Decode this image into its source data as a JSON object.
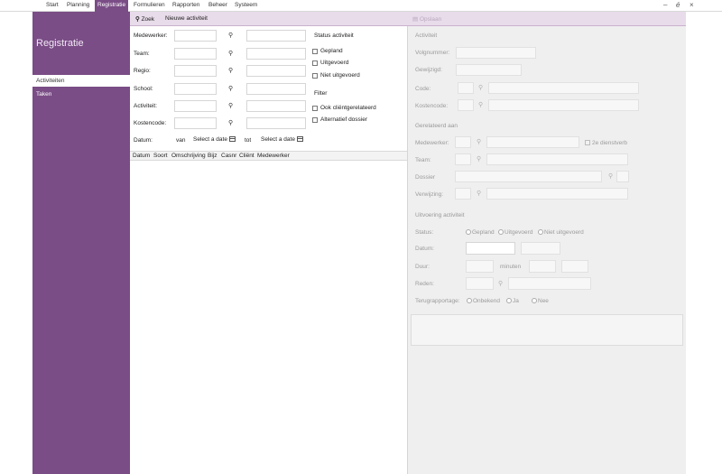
{
  "menu": {
    "items": [
      "Start",
      "Planning",
      "Registratie",
      "Formulieren",
      "Rapporten",
      "Beheer",
      "Systeem"
    ],
    "active": "Registratie"
  },
  "window": {
    "minimize": "–",
    "restore": "é",
    "close": "×"
  },
  "sidebar": {
    "title": "Registratie",
    "items": [
      {
        "label": "Activiteiten",
        "active": true
      },
      {
        "label": "Taken",
        "active": false
      }
    ]
  },
  "toolbar": {
    "search_label": "Zoek",
    "new_activity_label": "Nieuwe activiteit",
    "save_label": "Opslaan"
  },
  "search": {
    "fields": [
      "Medewerker:",
      "Team:",
      "Regio:",
      "School:",
      "Activiteit:",
      "Kostencode:"
    ],
    "status_title": "Status activiteit",
    "status_options": [
      "Gepland",
      "Uitgevoerd",
      "Niet uitgevoerd"
    ],
    "filter_title": "Filter",
    "filter_options": [
      "Ook cliëntgerelateerd",
      "Alternatief dossier"
    ],
    "date_label": "Datum:",
    "from_label": "van",
    "to_label": "tot",
    "date_placeholder_from": "Select a date",
    "date_placeholder_to": "Select a date"
  },
  "grid": {
    "columns": [
      "Datum",
      "Soort",
      "Omschrijving",
      "Bijz",
      "Casnr",
      "Cliënt",
      "Medewerker"
    ]
  },
  "detail": {
    "section_activity": "Activiteit",
    "volgnummer_label": "Volgnummer:",
    "gewijzigd_label": "Gewijzigd:",
    "code_label": "Code:",
    "kostencode_label": "Kostencode:",
    "section_related": "Gerelateerd aan",
    "medewerker_label": "Medewerker:",
    "second_worker_label": "2e dienstverb",
    "team_label": "Team:",
    "dossier_label": "Dossier",
    "verwijzing_label": "Verwijzing:",
    "section_execution": "Uitvoering activiteit",
    "status_label": "Status:",
    "status_options": [
      "Gepland",
      "Uitgevoerd",
      "Niet uitgevoerd"
    ],
    "datum_label": "Datum:",
    "duur_label": "Duur:",
    "minuten_label": "minuten",
    "reden_label": "Reden:",
    "terugrapportage_label": "Terugrapportage:",
    "terugrapportage_options": [
      "Onbekend",
      "Ja",
      "Nee"
    ]
  },
  "colors": {
    "accent": "#7a4d86",
    "toolbar": "#e8dbea",
    "detail_bg": "#efefef"
  }
}
